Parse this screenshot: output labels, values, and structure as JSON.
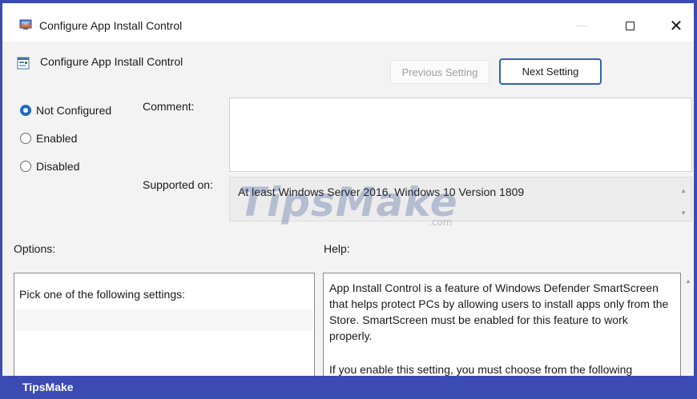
{
  "window": {
    "title": "Configure App Install Control",
    "maximize_icon": "square-icon",
    "close_glyph": "✕"
  },
  "policy": {
    "title": "Configure App Install Control",
    "previous_label": "Previous Setting",
    "next_label": "Next Setting"
  },
  "state": {
    "options": [
      {
        "label": "Not Configured",
        "checked": true
      },
      {
        "label": "Enabled",
        "checked": false
      },
      {
        "label": "Disabled",
        "checked": false
      }
    ]
  },
  "fields": {
    "comment_label": "Comment:",
    "comment_value": "",
    "supported_label": "Supported on:",
    "supported_value": "At least Windows Server 2016, Windows 10 Version 1809"
  },
  "sections": {
    "options_label": "Options:",
    "help_label": "Help:",
    "options_text": "Pick one of the following settings:",
    "help_paragraphs": [
      "App Install Control is a feature of Windows Defender SmartScreen that helps protect PCs by allowing users to install apps only from the Store.  SmartScreen must be enabled for this feature to work properly.",
      "If you enable this setting, you must choose from the following"
    ]
  },
  "watermark": {
    "brand": "TipsMake",
    "domain": ".com"
  },
  "footer": {
    "brand": "TipsMake"
  },
  "colors": {
    "accent": "#1f6bc2",
    "frame": "#3b4bb3",
    "next_border": "#2f63b8"
  }
}
